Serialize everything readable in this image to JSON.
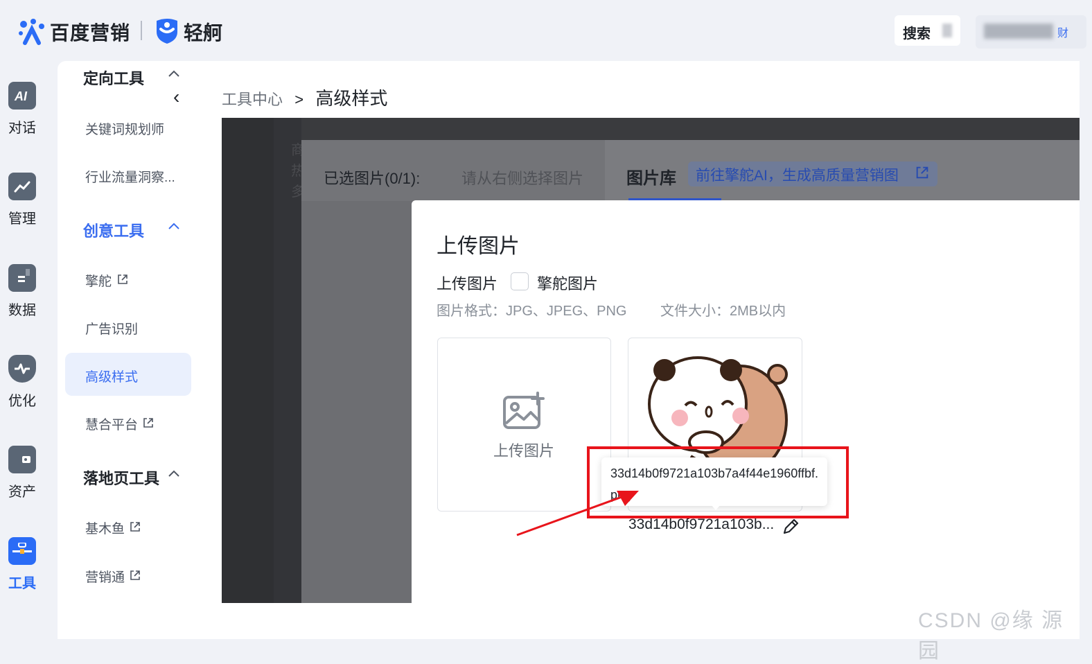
{
  "header": {
    "brand_primary": "百度营销",
    "brand_secondary": "轻舸",
    "search_label": "搜索",
    "user_tail": "财"
  },
  "rail": {
    "items": [
      {
        "label": "对话",
        "icon": "ai-chat-icon"
      },
      {
        "label": "管理",
        "icon": "trend-chart-icon"
      },
      {
        "label": "数据",
        "icon": "data-doc-icon"
      },
      {
        "label": "优化",
        "icon": "shield-pulse-icon"
      },
      {
        "label": "资产",
        "icon": "wallet-icon"
      },
      {
        "label": "工具",
        "icon": "toolbox-icon"
      }
    ],
    "active_color": "#3a6df0"
  },
  "sidebar": {
    "collapse_glyph": "‹",
    "sections": [
      {
        "title": "定向工具",
        "items": [
          "关键词规划师",
          "行业流量洞察..."
        ]
      },
      {
        "title": "创意工具",
        "items": [
          "擎舵",
          "广告识别",
          "高级样式",
          "慧合平台"
        ]
      },
      {
        "title": "落地页工具",
        "items": [
          "基木鱼",
          "营销通"
        ]
      }
    ]
  },
  "breadcrumb": {
    "parent": "工具中心",
    "separator": ">",
    "current": "高级样式"
  },
  "background_ghost": {
    "lines": [
      "商",
      "热",
      "多"
    ]
  },
  "picker": {
    "selected_label": "已选图片(0/1):",
    "selected_hint": "请从右侧选择图片",
    "library_title": "图片库",
    "library_link": "前往擎舵AI，生成高质量营销图"
  },
  "modal": {
    "title": "上传图片",
    "tab_upload": "上传图片",
    "tab_qingduo": "擎舵图片",
    "format_hint": "图片格式：JPG、JPEG、PNG",
    "size_hint": "文件大小：2MB以内",
    "upload_card_label": "上传图片",
    "image_filename_truncated": "33d14b0f9721a103b...",
    "tooltip_full_filename": "33d14b0f9721a103b7a4f44e1960ffbf.png"
  },
  "annotation": {
    "box_color": "#e8141b"
  },
  "watermark": "CSDN @缘  源  园"
}
